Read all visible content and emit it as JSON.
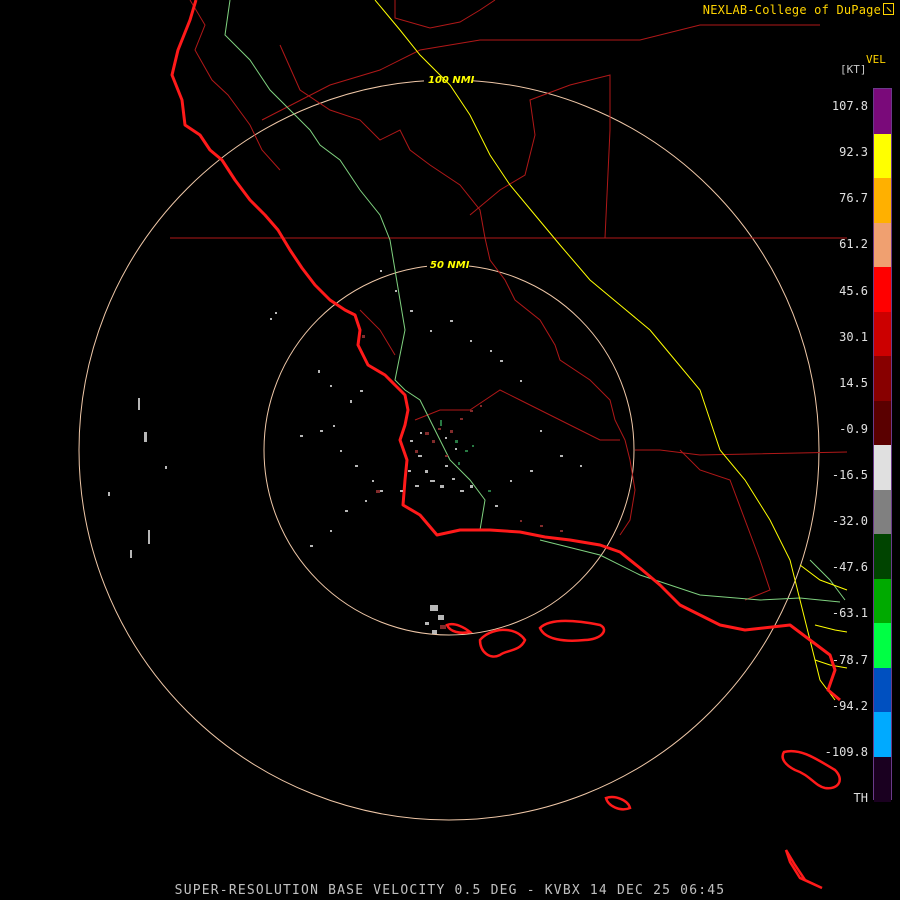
{
  "header": {
    "credit": "NEXLAB-College of DuPage"
  },
  "footer": {
    "caption": "SUPER-RESOLUTION BASE VELOCITY 0.5 DEG - KVBX 14 DEC 25 06:45"
  },
  "map": {
    "rings": [
      {
        "label": "100 NMI"
      },
      {
        "label": "50 NMI"
      }
    ],
    "colors": {
      "coastline": "#ff1a1a",
      "county_lines": "#b01818",
      "highway": "#ffff00",
      "rivers": "#7fd17f",
      "range_rings": "#f0c8a8"
    }
  },
  "legend": {
    "product": "VEL",
    "unit": "[KT]",
    "ticks": [
      "107.8",
      "92.3",
      "76.7",
      "61.2",
      "45.6",
      "30.1",
      "14.5",
      "-0.9",
      "-16.5",
      "-32.0",
      "-47.6",
      "-63.1",
      "-78.7",
      "-94.2",
      "-109.8",
      "TH"
    ],
    "colors": [
      "#7a0a7a",
      "#ffff00",
      "#ffb000",
      "#f0a070",
      "#ff0000",
      "#cc0000",
      "#880000",
      "#5a0000",
      "#e0e0e0",
      "#808080",
      "#004400",
      "#00aa00",
      "#00ff44",
      "#0050c0",
      "#00aaff",
      "#1a0020"
    ]
  }
}
